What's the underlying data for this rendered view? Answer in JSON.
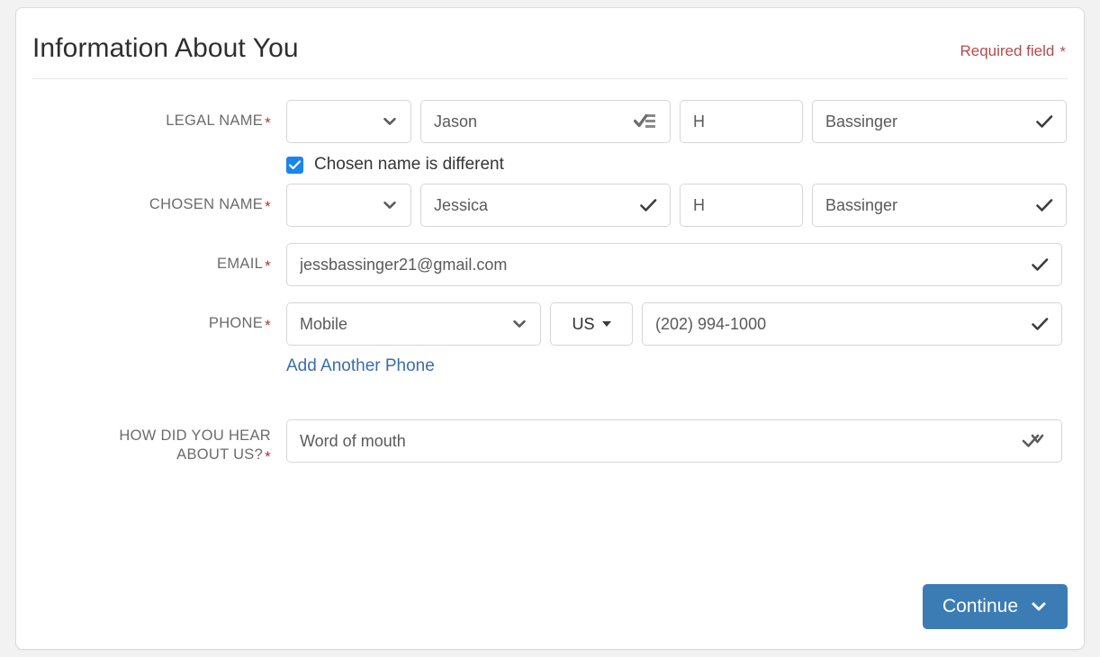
{
  "header": {
    "title": "Information About You",
    "required_note": "Required field",
    "required_star": "*"
  },
  "form": {
    "required_marker": "*",
    "legal_name": {
      "label": "LEGAL NAME",
      "prefix_value": "",
      "first_value": "Jason",
      "middle_value": "H",
      "last_value": "Bassinger",
      "first_icon": "autofill-icon",
      "last_icon": "check-icon"
    },
    "chosen_toggle": {
      "label": "Chosen name is different",
      "checked": true,
      "color": "#1a84ef"
    },
    "chosen_name": {
      "label": "CHOSEN NAME",
      "prefix_value": "",
      "first_value": "Jessica",
      "middle_value": "H",
      "last_value": "Bassinger",
      "prefix_icon": "check-icon",
      "first_icon": "check-icon",
      "last_icon": "check-icon"
    },
    "email": {
      "label": "EMAIL",
      "value": "jessbassinger21@gmail.com",
      "icon": "check-icon"
    },
    "phone": {
      "label": "PHONE",
      "type_value": "Mobile",
      "country_value": "US",
      "number_value": "(202) 994-1000",
      "number_icon": "check-icon",
      "add_another_label": "Add Another Phone",
      "link_color": "#3a6ea8"
    },
    "hear_about_us": {
      "label_line1": "HOW DID YOU HEAR",
      "label_line2": "ABOUT US?",
      "value": "Word of mouth",
      "icon": "check-and-chevron-icon"
    }
  },
  "footer": {
    "continue_label": "Continue",
    "continue_color": "#3b7cb5"
  }
}
